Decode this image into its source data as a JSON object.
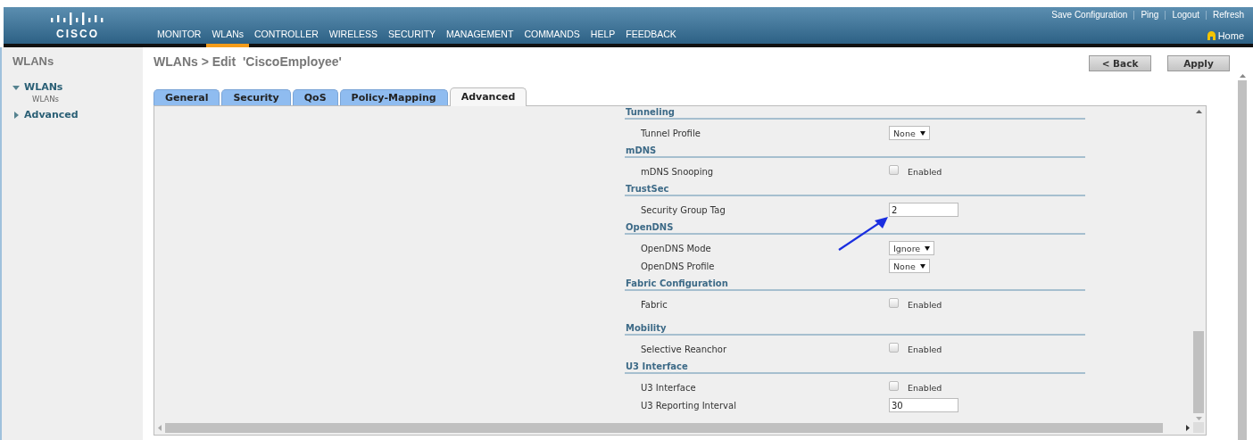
{
  "header": {
    "logo": "CISCO",
    "top_links": [
      "Save Configuration",
      "Ping",
      "Logout",
      "Refresh"
    ],
    "home": "Home",
    "nav": [
      {
        "label": "MONITOR",
        "selected": false
      },
      {
        "label": "WLANs",
        "selected": true
      },
      {
        "label": "CONTROLLER",
        "selected": false
      },
      {
        "label": "WIRELESS",
        "selected": false
      },
      {
        "label": "SECURITY",
        "selected": false
      },
      {
        "label": "MANAGEMENT",
        "selected": false
      },
      {
        "label": "COMMANDS",
        "selected": false
      },
      {
        "label": "HELP",
        "selected": false
      },
      {
        "label": "FEEDBACK",
        "selected": false
      }
    ]
  },
  "sidebar": {
    "title": "WLANs",
    "items": [
      {
        "label": "WLANs",
        "expanded": true,
        "children": [
          {
            "label": "WLANs"
          }
        ]
      },
      {
        "label": "Advanced",
        "expanded": false
      }
    ]
  },
  "page_title": "WLANs > Edit  'CiscoEmployee'",
  "buttons": [
    "< Back",
    "Apply"
  ],
  "tabs": [
    {
      "label": "General",
      "selected": false
    },
    {
      "label": "Security",
      "selected": false
    },
    {
      "label": "QoS",
      "selected": false
    },
    {
      "label": "Policy-Mapping",
      "selected": false
    },
    {
      "label": "Advanced",
      "selected": true
    }
  ],
  "sections": [
    {
      "title": "Tunneling",
      "rows": [
        {
          "kind": "select",
          "label": "Tunnel Profile",
          "value": "None"
        }
      ]
    },
    {
      "title": "mDNS",
      "rows": [
        {
          "kind": "checkbox",
          "label": "mDNS Snooping",
          "text": "Enabled",
          "checked": false
        }
      ]
    },
    {
      "title": "TrustSec",
      "rows": [
        {
          "kind": "text",
          "label": "Security Group Tag",
          "value": "2"
        }
      ]
    },
    {
      "title": "OpenDNS",
      "rows": [
        {
          "kind": "select",
          "label": "OpenDNS Mode",
          "value": "Ignore"
        },
        {
          "kind": "select",
          "label": "OpenDNS Profile",
          "value": "None"
        }
      ]
    },
    {
      "title": "Fabric Configuration",
      "rows": [
        {
          "kind": "checkbox",
          "label": "Fabric",
          "text": "Enabled",
          "checked": false
        }
      ]
    },
    {
      "title": "Mobility",
      "rows": [
        {
          "kind": "checkbox",
          "label": "Selective Reanchor",
          "text": "Enabled",
          "checked": false
        }
      ]
    },
    {
      "title": "U3 Interface",
      "rows": [
        {
          "kind": "checkbox",
          "label": "U3 Interface",
          "text": "Enabled",
          "checked": false
        },
        {
          "kind": "text",
          "label": "U3 Reporting Interval",
          "value": "30"
        }
      ]
    }
  ]
}
